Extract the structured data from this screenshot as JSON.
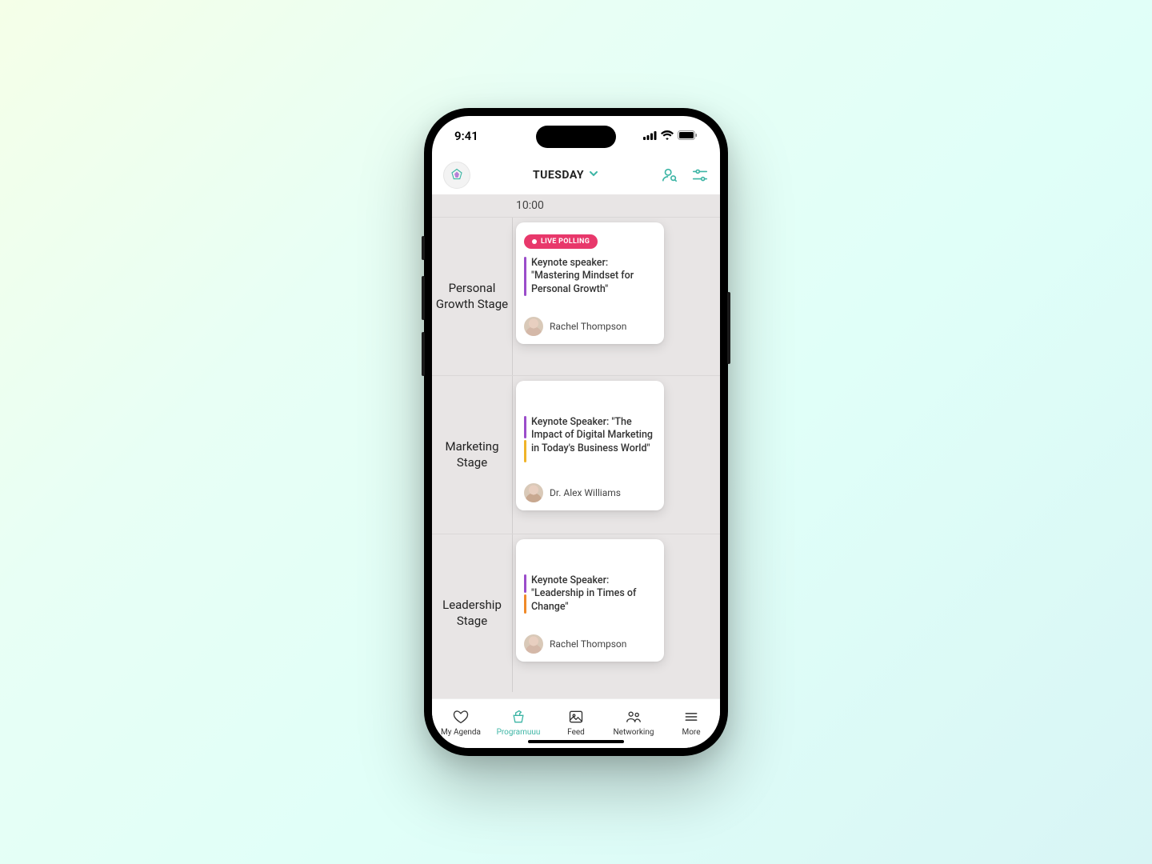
{
  "status": {
    "time": "9:41"
  },
  "header": {
    "day_label": "TUESDAY"
  },
  "timeline": {
    "time_marker": "10:00",
    "stages": [
      {
        "name": "Personal Growth Stage",
        "badge": "LIVE POLLING",
        "title": "Keynote speaker: \"Mastering Mindset for Personal Growth\"",
        "speaker": "Rachel Thompson"
      },
      {
        "name": "Marketing Stage",
        "title": "Keynote Speaker: \"The Impact of Digital Marketing in Today's Business World\"",
        "speaker": "Dr. Alex Williams"
      },
      {
        "name": "Leadership Stage",
        "title": "Keynote Speaker: \"Leadership in Times of Change\"",
        "speaker": "Rachel Thompson"
      }
    ]
  },
  "tabs": {
    "agenda": "My Agenda",
    "program": "Programuuu",
    "feed": "Feed",
    "networking": "Networking",
    "more": "More"
  }
}
